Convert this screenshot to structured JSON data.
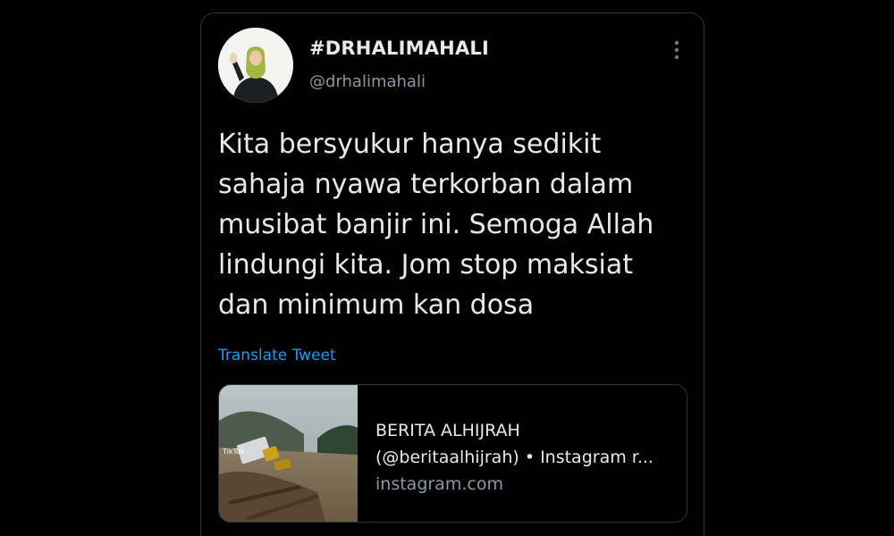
{
  "tweet": {
    "display_name": "#DRHALIMAHALI",
    "handle": "@drhalimahali",
    "text": "Kita bersyukur hanya sedikit\nsahaja nyawa terkorban dalam\nmusibat banjir ini. Semoga Allah\nlindungi kita. Jom stop maksiat\ndan minimum kan dosa",
    "translate_label": "Translate Tweet",
    "more_icon": "more-vertical-icon"
  },
  "link_card": {
    "title": "BERITA ALHIJRAH",
    "description": "(@beritaalhijrah) • Instagram r...",
    "domain": "instagram.com",
    "thumb_watermark": "TikTok"
  },
  "colors": {
    "background": "#000000",
    "text_primary": "#e7e9ea",
    "text_secondary": "#8b98a5",
    "link": "#1d9bf0",
    "border": "#2f3336"
  }
}
